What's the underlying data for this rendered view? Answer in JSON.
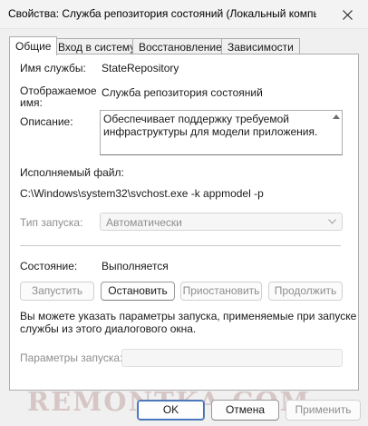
{
  "window": {
    "title": "Свойства: Служба репозитория состояний (Локальный компью..."
  },
  "tabs": [
    {
      "label": "Общие",
      "active": true
    },
    {
      "label": "Вход в систему",
      "active": false
    },
    {
      "label": "Восстановление",
      "active": false
    },
    {
      "label": "Зависимости",
      "active": false
    }
  ],
  "general": {
    "service_name_label": "Имя службы:",
    "service_name_value": "StateRepository",
    "display_name_label_1": "Отображаемое",
    "display_name_label_2": "имя:",
    "display_name_value": "Служба репозитория состояний",
    "description_label": "Описание:",
    "description_value": "Обеспечивает поддержку требуемой инфраструктуры для модели приложения.",
    "exe_label": "Исполняемый файл:",
    "exe_value": "C:\\Windows\\system32\\svchost.exe -k appmodel -p",
    "startup_type_label": "Тип запуска:",
    "startup_type_value": "Автоматически",
    "status_label": "Состояние:",
    "status_value": "Выполняется",
    "buttons": {
      "start": "Запустить",
      "stop": "Остановить",
      "pause": "Приостановить",
      "resume": "Продолжить"
    },
    "hint_line_1": "Вы можете указать параметры запуска, применяемые при запуске",
    "hint_line_2": "службы из этого диалогового окна.",
    "start_params_label": "Параметры запуска:",
    "start_params_value": ""
  },
  "footer": {
    "ok": "OK",
    "cancel": "Отмена",
    "apply": "Применить"
  },
  "watermark": "REMONTKA.COM",
  "icons": {
    "close": "close-icon",
    "combo": "chevron-down-icon",
    "scroll": "scroll-up-icon"
  }
}
